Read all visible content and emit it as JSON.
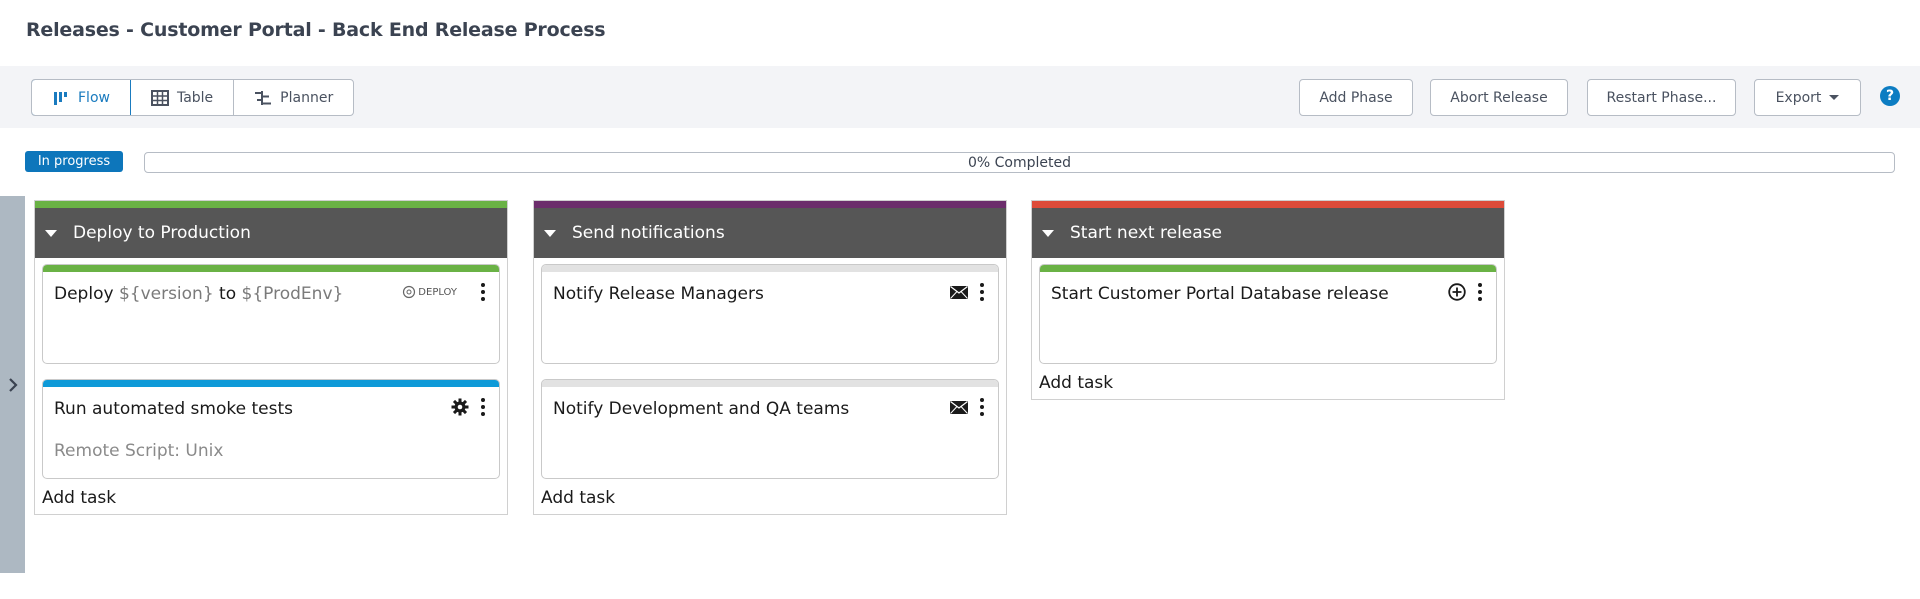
{
  "header": {
    "title": "Releases - Customer Portal - Back End Release Process"
  },
  "toolbar": {
    "views": [
      {
        "label": "Flow",
        "icon": "flow-icon",
        "active": true
      },
      {
        "label": "Table",
        "icon": "table-icon",
        "active": false
      },
      {
        "label": "Planner",
        "icon": "planner-icon",
        "active": false
      }
    ],
    "actions": {
      "add_phase": "Add Phase",
      "abort_release": "Abort Release",
      "restart_phase": "Restart Phase...",
      "export": "Export"
    },
    "help_icon": "?"
  },
  "status": {
    "badge": "In progress",
    "progress_percent": 0,
    "progress_label": "0% Completed",
    "badge_color": "#0d76bb"
  },
  "phases": [
    {
      "title": "Deploy to Production",
      "color": "#6ab245",
      "tasks": [
        {
          "title_parts": [
            "Deploy ",
            "${version}",
            " to ",
            "${ProdEnv}"
          ],
          "bar_color": "#6ab245",
          "icon": "deploy-logo",
          "icon_text": "DEPLOY",
          "subtitle": ""
        },
        {
          "title": "Run automated smoke tests",
          "bar_color": "#0e9ad8",
          "icon": "gear-icon",
          "subtitle": "Remote Script: Unix"
        }
      ],
      "add_task": "Add task"
    },
    {
      "title": "Send notifications",
      "color": "#6b2d6b",
      "tasks": [
        {
          "title": "Notify Release Managers",
          "bar_color": "#e2e2e2",
          "icon": "mail-icon",
          "subtitle": ""
        },
        {
          "title": "Notify Development and QA teams",
          "bar_color": "#e2e2e2",
          "icon": "mail-icon",
          "subtitle": ""
        }
      ],
      "add_task": "Add task"
    },
    {
      "title": "Start next release",
      "color": "#dd4b39",
      "tasks": [
        {
          "title": "Start Customer Portal Database release",
          "bar_color": "#6ab245",
          "icon": "add-circle-icon",
          "subtitle": ""
        }
      ],
      "add_task": "Add task"
    }
  ]
}
